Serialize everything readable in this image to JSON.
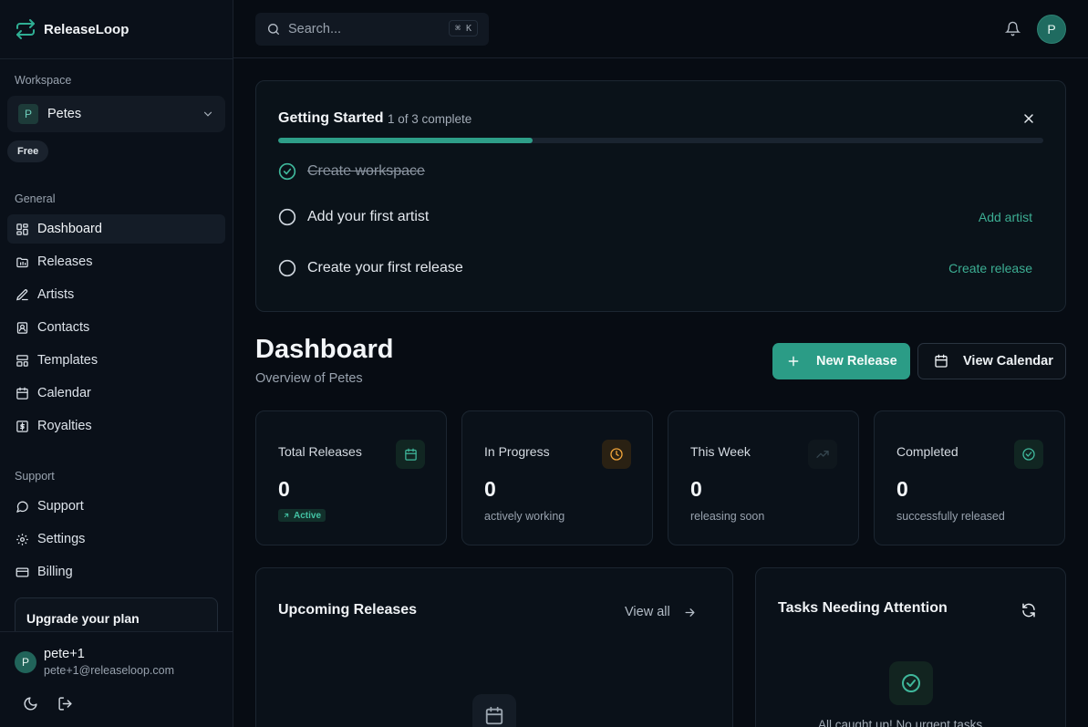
{
  "brand": {
    "name": "ReleaseLoop"
  },
  "sidebar": {
    "workspace_label": "Workspace",
    "workspace": {
      "initial": "P",
      "name": "Petes"
    },
    "plan_badge": "Free",
    "general_label": "General",
    "general_items": [
      {
        "label": "Dashboard",
        "icon": "dashboard-icon",
        "active": true
      },
      {
        "label": "Releases",
        "icon": "releases-icon"
      },
      {
        "label": "Artists",
        "icon": "artists-icon"
      },
      {
        "label": "Contacts",
        "icon": "contacts-icon"
      },
      {
        "label": "Templates",
        "icon": "templates-icon"
      },
      {
        "label": "Calendar",
        "icon": "calendar-icon"
      },
      {
        "label": "Royalties",
        "icon": "royalties-icon"
      }
    ],
    "support_label": "Support",
    "support_items": [
      {
        "label": "Support",
        "icon": "chat-icon"
      },
      {
        "label": "Settings",
        "icon": "gear-icon"
      },
      {
        "label": "Billing",
        "icon": "credit-card-icon"
      }
    ],
    "upgrade_title": "Upgrade your plan",
    "user": {
      "initial": "P",
      "name": "pete+1",
      "email": "pete+1@releaseloop.com"
    }
  },
  "topbar": {
    "search_placeholder": "Search...",
    "shortcut": "⌘ K",
    "avatar_initial": "P"
  },
  "getting_started": {
    "title": "Getting Started",
    "progress_label": "1 of 3 complete",
    "progress": 0.333,
    "steps": [
      {
        "label": "Create workspace",
        "done": true,
        "action": ""
      },
      {
        "label": "Add your first artist",
        "done": false,
        "action": "Add artist"
      },
      {
        "label": "Create your first release",
        "done": false,
        "action": "Create release"
      }
    ]
  },
  "dashboard": {
    "title": "Dashboard",
    "subtitle": "Overview of Petes",
    "new_release_label": "New Release",
    "view_calendar_label": "View Calendar"
  },
  "stats": [
    {
      "label": "Total Releases",
      "value": "0",
      "badge": "Active",
      "sub": "",
      "icon": "calendar-icon",
      "color": "#3fb79b"
    },
    {
      "label": "In Progress",
      "value": "0",
      "badge": "",
      "sub": "actively working",
      "icon": "clock-icon",
      "color": "#f0a43a"
    },
    {
      "label": "This Week",
      "value": "0",
      "badge": "",
      "sub": "releasing soon",
      "icon": "trending-up-icon",
      "color": "#3a4a52"
    },
    {
      "label": "Completed",
      "value": "0",
      "badge": "",
      "sub": "successfully released",
      "icon": "check-circle-icon",
      "color": "#3fb79b"
    }
  ],
  "upcoming": {
    "title": "Upcoming Releases",
    "view_all": "View all"
  },
  "tasks": {
    "title": "Tasks Needing Attention",
    "empty_text": "All caught up! No urgent tasks"
  },
  "colors": {
    "accent": "#2b9c86",
    "background": "#070c13",
    "card": "#0a1119"
  }
}
